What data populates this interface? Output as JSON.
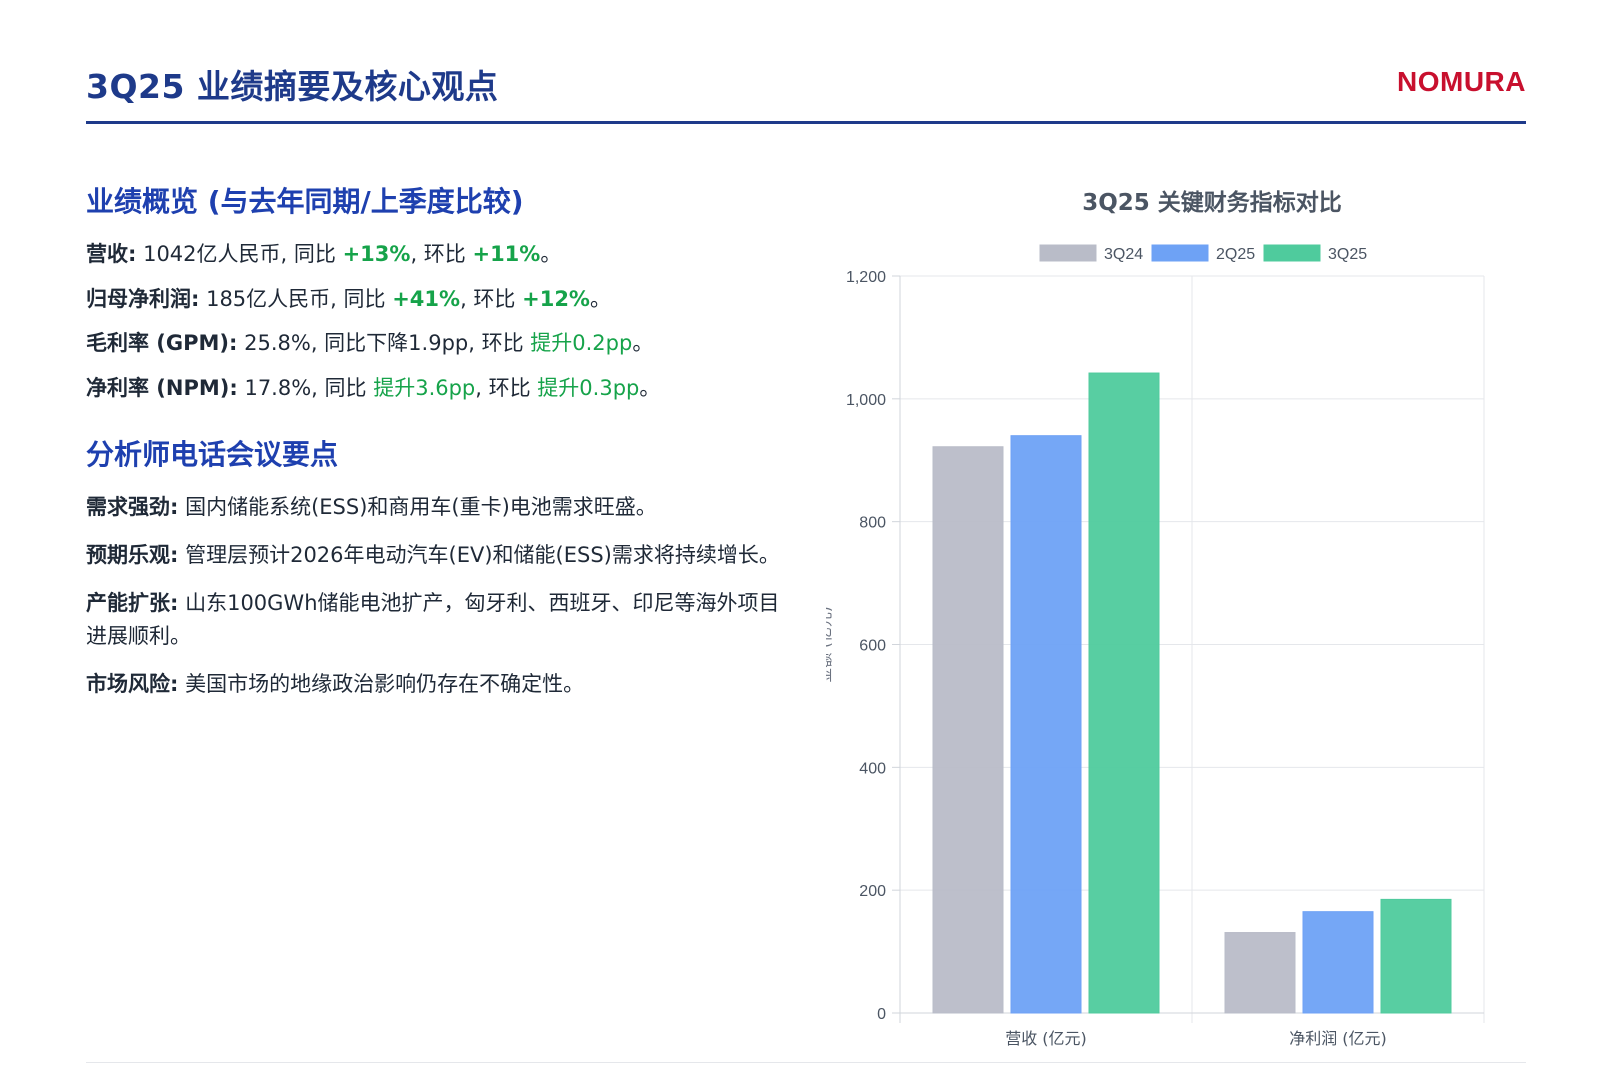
{
  "header": {
    "title": "3Q25 业绩摘要及核心观点",
    "brand": "NOMURA"
  },
  "overview": {
    "heading": "业绩概览 (与去年同期/上季度比较)",
    "items": [
      {
        "label": "营收:",
        "parts": [
          {
            "text": " 1042亿人民币, 同比 "
          },
          {
            "text": "+13%",
            "style": "pos-strong"
          },
          {
            "text": ", 环比 "
          },
          {
            "text": "+11%",
            "style": "pos-strong"
          },
          {
            "text": "。"
          }
        ]
      },
      {
        "label": "归母净利润:",
        "parts": [
          {
            "text": " 185亿人民币, 同比 "
          },
          {
            "text": "+41%",
            "style": "pos-strong"
          },
          {
            "text": ", 环比 "
          },
          {
            "text": "+12%",
            "style": "pos-strong"
          },
          {
            "text": "。"
          }
        ]
      },
      {
        "label": "毛利率 (GPM):",
        "parts": [
          {
            "text": " 25.8%, 同比下降1.9pp, 环比 "
          },
          {
            "text": "提升0.2pp",
            "style": "pos"
          },
          {
            "text": "。"
          }
        ]
      },
      {
        "label": "净利率 (NPM):",
        "parts": [
          {
            "text": " 17.8%, 同比 "
          },
          {
            "text": "提升3.6pp",
            "style": "pos"
          },
          {
            "text": ", 环比 "
          },
          {
            "text": "提升0.3pp",
            "style": "pos"
          },
          {
            "text": "。"
          }
        ]
      }
    ]
  },
  "call_points": {
    "heading": "分析师电话会议要点",
    "items": [
      {
        "label": "需求强劲:",
        "text": " 国内储能系统(ESS)和商用车(重卡)电池需求旺盛。"
      },
      {
        "label": "预期乐观:",
        "text": " 管理层预计2026年电动汽车(EV)和储能(ESS)需求将持续增长。"
      },
      {
        "label": "产能扩张:",
        "text": " 山东100GWh储能电池扩产，匈牙利、西班牙、印尼等海外项目进展顺利。"
      },
      {
        "label": "市场风险:",
        "text": " 美国市场的地缘政治影响仍存在不确定性。"
      }
    ]
  },
  "chart_data": {
    "type": "bar",
    "title": "3Q25 关键财务指标对比",
    "categories": [
      "营收 (亿元)",
      "净利润 (亿元)"
    ],
    "series": [
      {
        "name": "3Q24",
        "values": [
          922,
          131
        ],
        "color": "#b9bcc8"
      },
      {
        "name": "2Q25",
        "values": [
          940,
          165
        ],
        "color": "#6ea2f5"
      },
      {
        "name": "3Q25",
        "values": [
          1042,
          185
        ],
        "color": "#4fcb9d"
      }
    ],
    "ylabel": "金额 (亿元)",
    "xlabel": "",
    "ylim": [
      0,
      1200
    ],
    "yticks": [
      0,
      200,
      400,
      600,
      800,
      1000,
      1200
    ],
    "ytick_labels": [
      "0",
      "200",
      "400",
      "600",
      "800",
      "1,000",
      "1,200"
    ],
    "legend": "top",
    "grid": true
  }
}
